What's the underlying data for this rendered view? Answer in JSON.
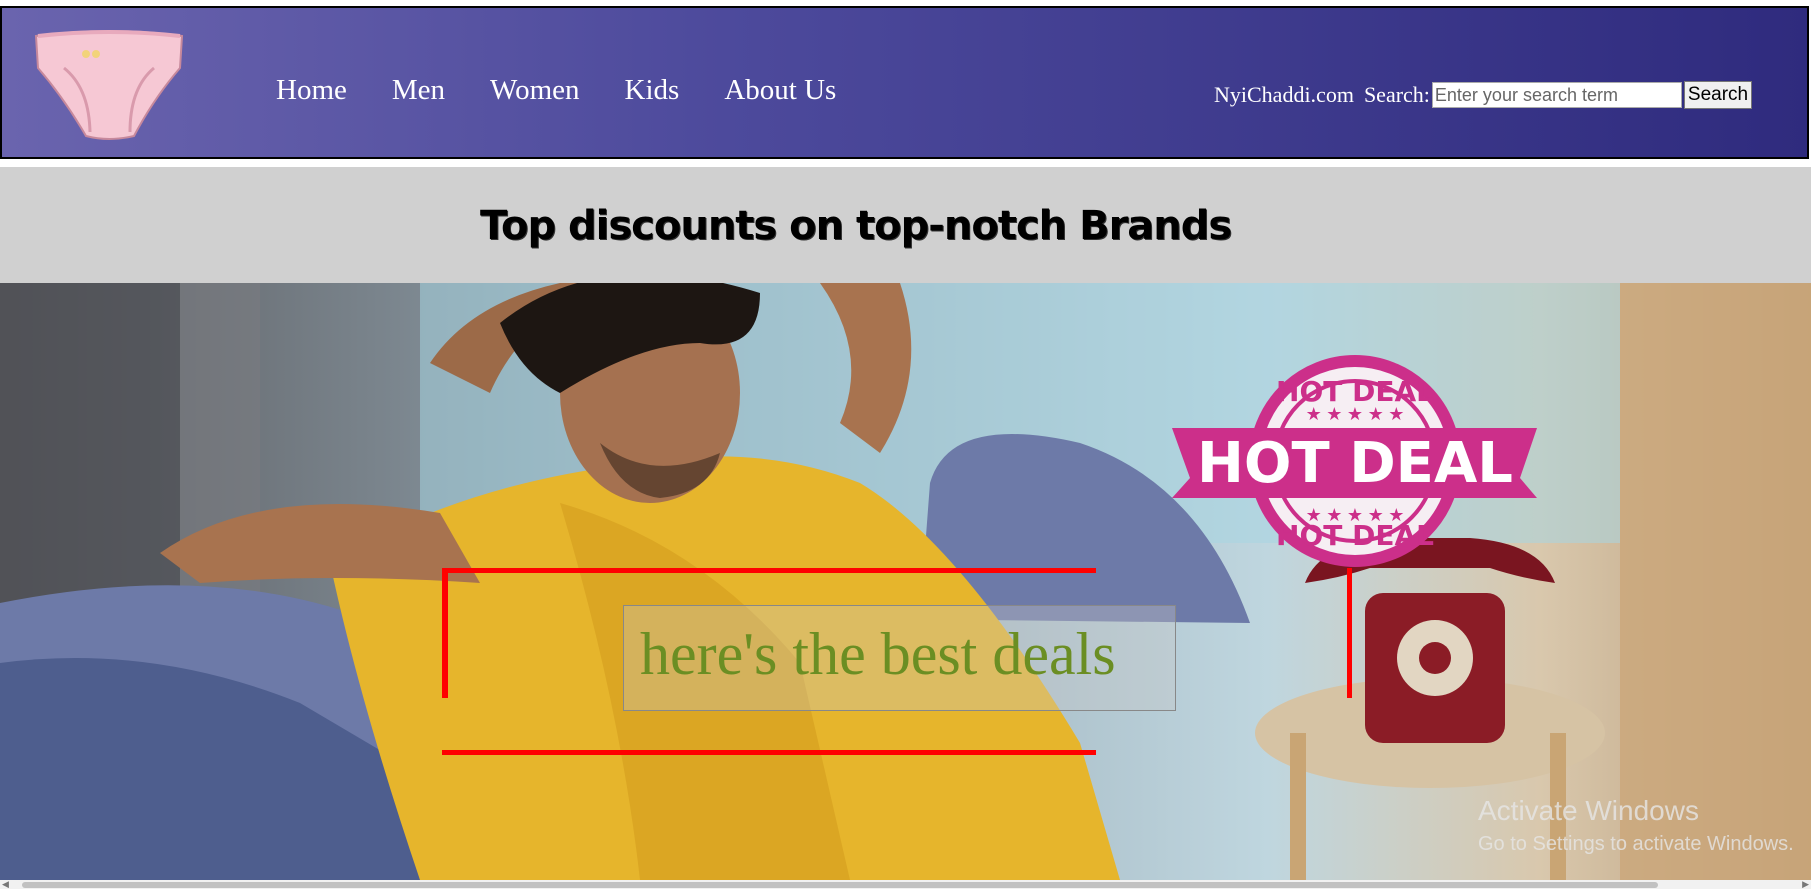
{
  "header": {
    "logo_icon": "underwear-logo-icon",
    "nav": [
      {
        "label": "Home"
      },
      {
        "label": "Men"
      },
      {
        "label": "Women"
      },
      {
        "label": "Kids"
      },
      {
        "label": "About Us"
      }
    ],
    "brand": "NyiChaddi.com",
    "search_label": "Search:",
    "search_placeholder": "Enter your search term",
    "search_button": "Search"
  },
  "banner": {
    "title": "Top discounts on top-notch Brands"
  },
  "hero": {
    "stamp_text_top": "HOT DEAL",
    "stamp_text_main": "HOT DEAL",
    "stamp_text_bottom": "HOT DEAL",
    "caption": "here's the best deals"
  },
  "watermark": {
    "line1": "Activate Windows",
    "line2": "Go to Settings to activate Windows."
  },
  "colors": {
    "header_start": "#6a64ae",
    "header_end": "#2f2b7e",
    "banner_bg": "#d0d0d0",
    "caption_color": "#6b8e23",
    "stamp_color": "#cc2f8a",
    "accent_red": "#ff0000"
  }
}
